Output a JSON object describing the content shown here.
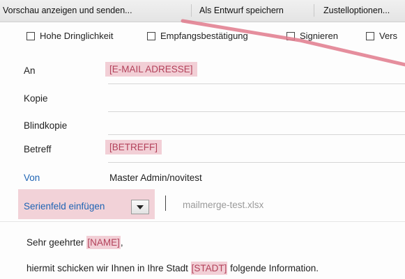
{
  "toolbar": {
    "preview_send": "Vorschau anzeigen und senden...",
    "save_draft": "Als Entwurf speichern",
    "delivery_options": "Zustelloptionen..."
  },
  "options": [
    {
      "label": "Hohe Dringlichkeit",
      "checked": false
    },
    {
      "label": "Empfangsbestätigung",
      "checked": false
    },
    {
      "label": "Signieren",
      "checked": false
    },
    {
      "label": "Vers",
      "checked": false
    }
  ],
  "fields": {
    "to": {
      "label": "An",
      "value": "[E-MAIL ADRESSE]"
    },
    "cc": {
      "label": "Kopie",
      "value": ""
    },
    "bcc": {
      "label": "Blindkopie",
      "value": ""
    },
    "subject": {
      "label": "Betreff",
      "value": "[BETREFF]"
    },
    "from": {
      "label": "Von",
      "value": "Master Admin/novitest"
    }
  },
  "merge": {
    "label": "Serienfeld einfügen",
    "attachment": "mailmerge-test.xlsx"
  },
  "body": {
    "line1_prefix": "Sehr geehrter ",
    "line1_tag": "[NAME]",
    "line1_suffix": ",",
    "line2_prefix": "hiermit schicken wir Ihnen in Ihre Stadt ",
    "line2_tag": "[STADT]",
    "line2_suffix": " folgende Information."
  },
  "colors": {
    "highlight": "#dc788c",
    "link_blue": "#1e64b4",
    "annotation": "#e07a8c"
  }
}
